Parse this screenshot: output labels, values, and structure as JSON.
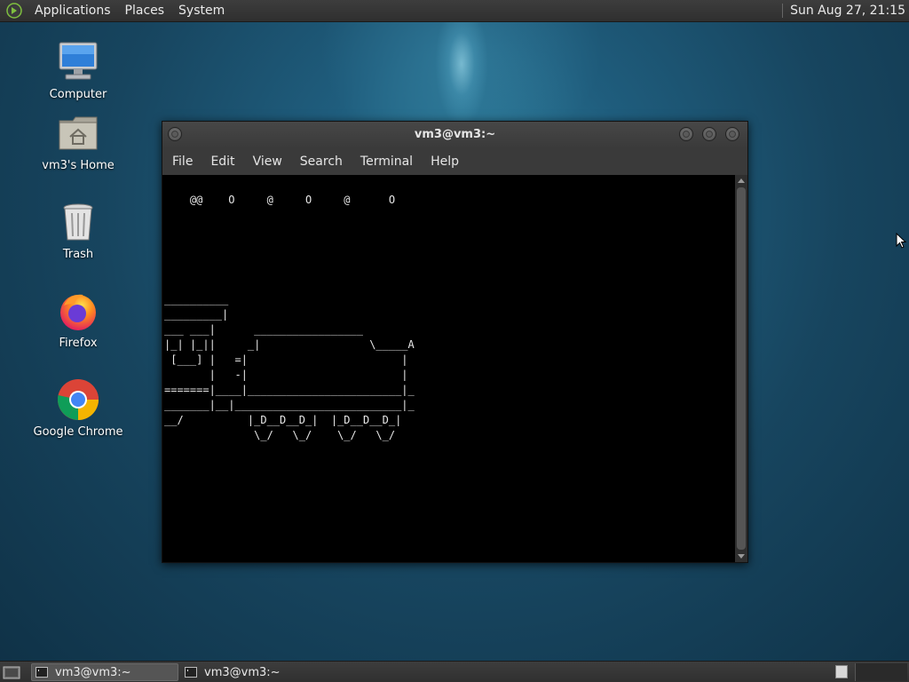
{
  "top_panel": {
    "menus": [
      "Applications",
      "Places",
      "System"
    ],
    "clock": "Sun Aug 27, 21:15"
  },
  "desktop_icons": {
    "computer": "Computer",
    "home": "vm3's Home",
    "trash": "Trash",
    "firefox": "Firefox",
    "chrome": "Google Chrome"
  },
  "terminal": {
    "title": "vm3@vm3:~",
    "menu": [
      "File",
      "Edit",
      "View",
      "Search",
      "Terminal",
      "Help"
    ],
    "smoke_line": "    @@    O     @     O     @      O",
    "train_lines": [
      "__________",
      "_________|",
      "___ ___|      _________________",
      "|_| |_||     _|                 \\_____A",
      " [___] |   =|                        |",
      "       |   -|                        |",
      "=======|____|________________________|_",
      "_______|__|__________________________|_",
      "__/          |_D__D__D_|  |_D__D__D_|",
      "              \\_/   \\_/    \\_/   \\_/"
    ]
  },
  "taskbar": {
    "tasks": [
      "vm3@vm3:~",
      "vm3@vm3:~"
    ]
  },
  "colors": {
    "panel": "#333333",
    "terminal_bg": "#000000",
    "desktop": "#1f5d7d"
  }
}
